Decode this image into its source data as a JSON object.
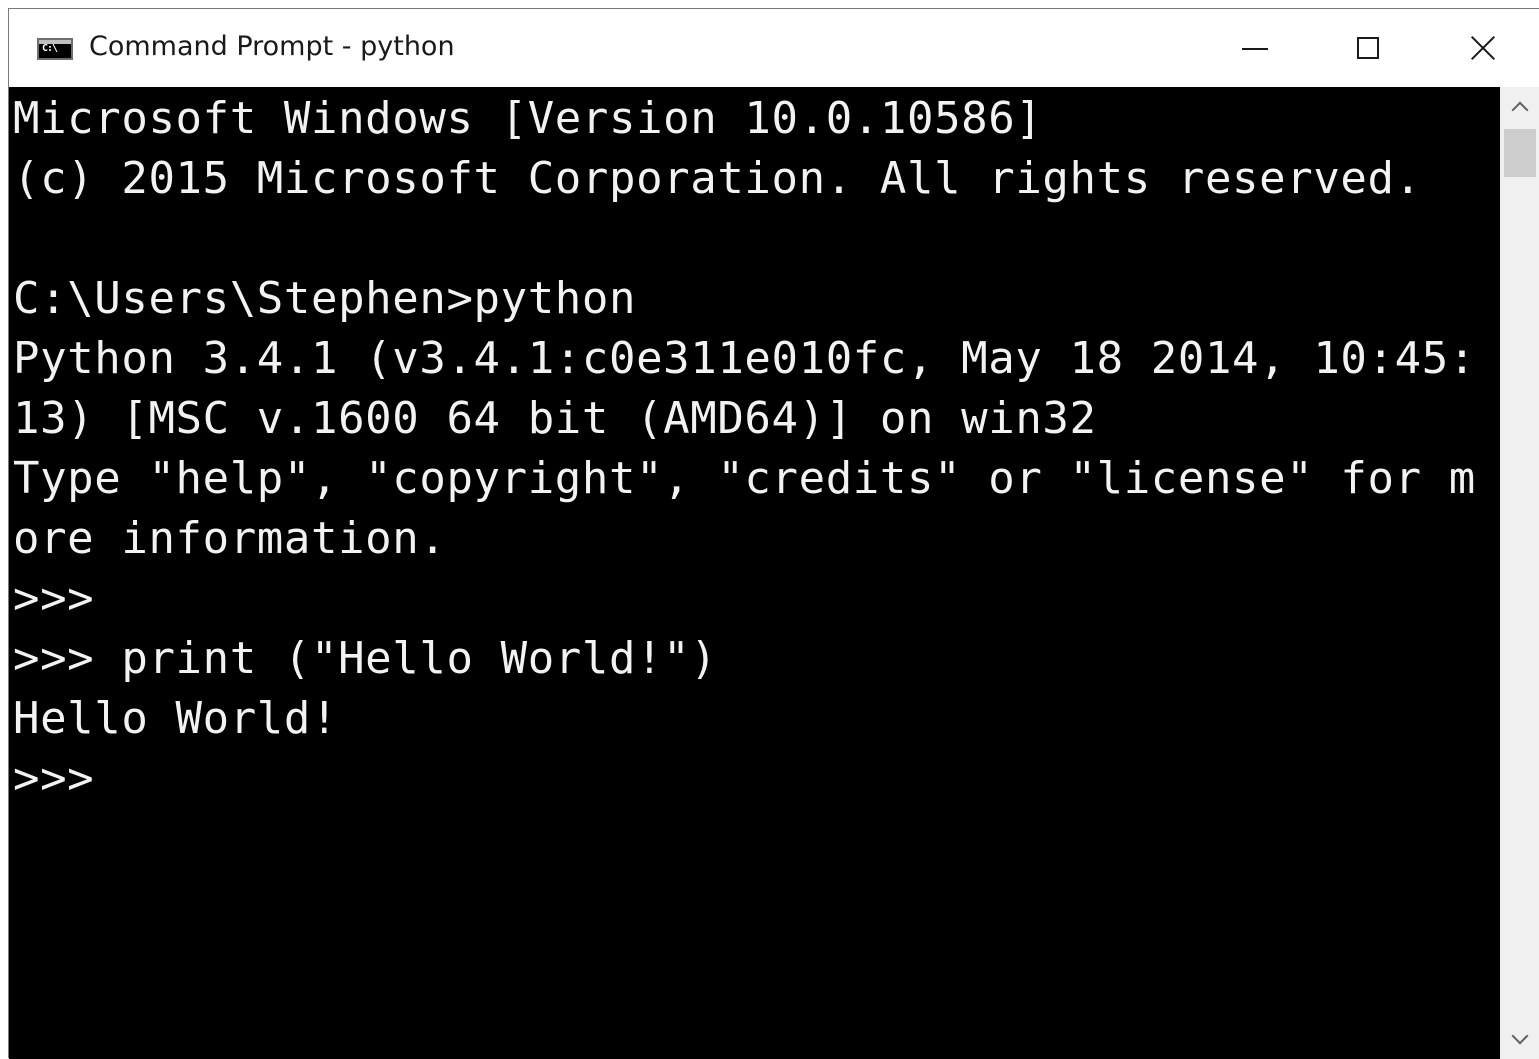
{
  "window": {
    "title": "Command Prompt - python",
    "icon": "console-app-icon",
    "icon_glyph": "C:\\",
    "controls": {
      "minimize": "minimize-icon",
      "maximize": "maximize-icon",
      "close": "close-icon"
    }
  },
  "console": {
    "background": "#000000",
    "foreground": "#f2f2f2",
    "lines": [
      "Microsoft Windows [Version 10.0.10586]",
      "(c) 2015 Microsoft Corporation. All rights reserved.",
      "",
      "C:\\Users\\Stephen>python",
      "Python 3.4.1 (v3.4.1:c0e311e010fc, May 18 2014, 10:45:",
      "13) [MSC v.1600 64 bit (AMD64)] on win32",
      "Type \"help\", \"copyright\", \"credits\" or \"license\" for m",
      "ore information.",
      ">>>",
      ">>> print (\"Hello World!\")",
      "Hello World!",
      ">>>"
    ]
  },
  "scrollbar": {
    "up_icon": "chevron-up-icon",
    "down_icon": "chevron-down-icon"
  }
}
